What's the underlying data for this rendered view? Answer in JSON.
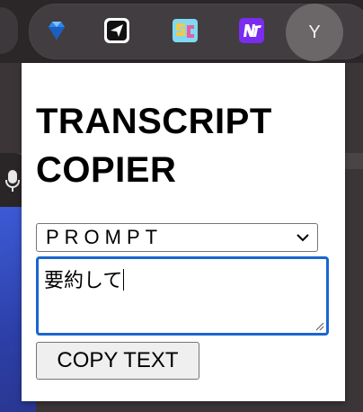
{
  "browser_toolbar": {
    "extensions": [
      {
        "name": "diamond-extension",
        "icon": "blue-diamond-icon"
      },
      {
        "name": "send-extension",
        "icon": "paper-plane-icon"
      },
      {
        "name": "sc-extension",
        "icon": "sc-logo-icon"
      },
      {
        "name": "nt-extension",
        "icon": "nt-logo-icon"
      }
    ],
    "profile": {
      "initial": "Y"
    }
  },
  "popup": {
    "title": "TRANSCRIPT COPIER",
    "prompt_select": {
      "selected": "PROMPT"
    },
    "prompt_textarea": {
      "value": "要約して"
    },
    "copy_button": {
      "label": "COPY TEXT"
    }
  },
  "colors": {
    "accent_focus": "#1a66d0",
    "toolbar_bg": "#2b2729",
    "popup_bg": "#ffffff"
  }
}
